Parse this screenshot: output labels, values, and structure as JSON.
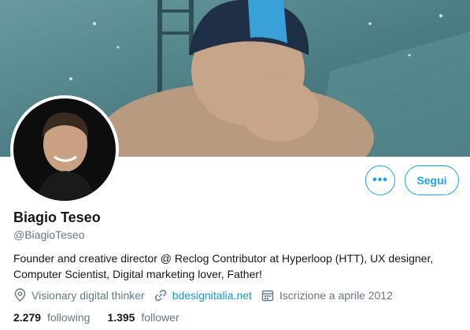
{
  "profile": {
    "name": "Biagio Teseo",
    "handle": "@BiagioTeseo",
    "bio": "Founder and creative director @ Reclog Contributor at Hyperloop (HTT), UX designer, Computer Scientist, Digital marketing lover, Father!",
    "location": "Visionary digital thinker",
    "website": "bdesignitalia.net",
    "joined": "Iscrizione a aprile 2012"
  },
  "stats": {
    "following_count": "2.279",
    "following_label": "following",
    "follower_count": "1.395",
    "follower_label": "follower"
  },
  "actions": {
    "more_label": "•••",
    "follow_label": "Segui"
  },
  "icons": {
    "location": "location-pin-icon",
    "link": "link-icon",
    "calendar": "calendar-icon",
    "more": "more-options-icon"
  },
  "colors": {
    "accent": "#1da1f2",
    "link": "#1b95e0",
    "secondary_text": "#657786",
    "primary_text": "#14171a"
  }
}
